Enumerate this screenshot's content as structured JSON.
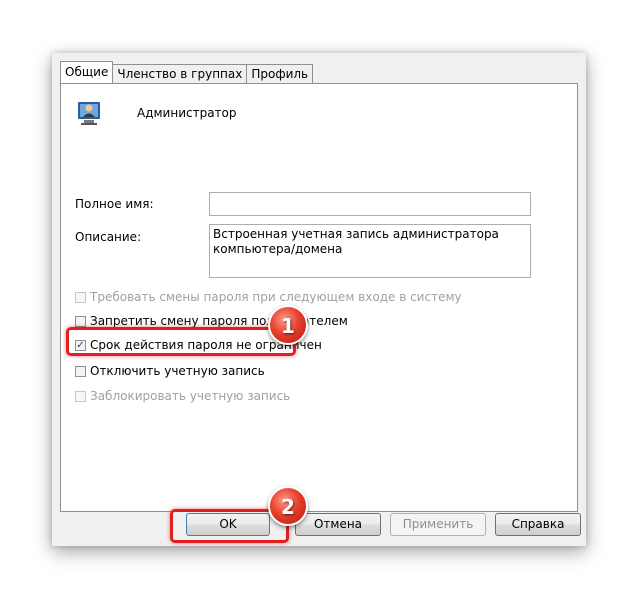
{
  "tabs": [
    {
      "label": "Общие",
      "active": true
    },
    {
      "label": "Членство в группах",
      "active": false
    },
    {
      "label": "Профиль",
      "active": false
    }
  ],
  "user": {
    "name": "Администратор",
    "icon": "user-icon"
  },
  "fields": {
    "full_name_label": "Полное имя:",
    "full_name_value": "",
    "description_label": "Описание:",
    "description_value": "Встроенная учетная запись администратора компьютера/домена"
  },
  "checkboxes": [
    {
      "label": "Требовать смены пароля при следующем входе в систему",
      "checked": false,
      "enabled": false
    },
    {
      "label": "Запретить смену пароля пользователем",
      "checked": false,
      "enabled": true
    },
    {
      "label": "Срок действия пароля не ограничен",
      "checked": true,
      "enabled": true
    },
    {
      "label": "Отключить учетную запись",
      "checked": false,
      "enabled": true
    },
    {
      "label": "Заблокировать учетную запись",
      "checked": false,
      "enabled": false
    }
  ],
  "buttons": {
    "ok": "OK",
    "cancel": "Отмена",
    "apply": "Применить",
    "help": "Справка"
  },
  "annotations": {
    "badge1": "1",
    "badge2": "2",
    "color": "#e02020"
  }
}
